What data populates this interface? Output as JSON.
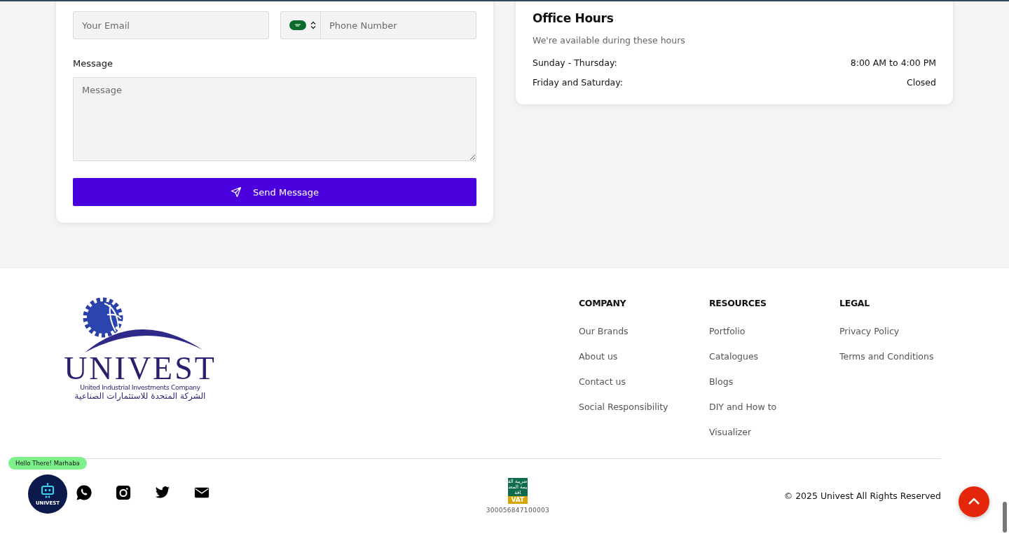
{
  "contact_form": {
    "email": {
      "placeholder": "Your Email"
    },
    "phone": {
      "placeholder": "Phone Number"
    },
    "message_label": "Message",
    "message": {
      "placeholder": "Message"
    },
    "submit": "Send Message"
  },
  "office_hours": {
    "title": "Office Hours",
    "subtitle": "We're available during these hours",
    "rows": [
      {
        "days": "Sunday - Thursday:",
        "hours": "8:00 AM to 4:00 PM"
      },
      {
        "days": "Friday and Saturday:",
        "hours": "Closed"
      }
    ]
  },
  "footer": {
    "logo": {
      "name": "UNIVEST",
      "tagline": "United Industrial Investments Company",
      "arabic": "الشركة المتحدة للاستثمارات الصناعية"
    },
    "columns": [
      {
        "title": "COMPANY",
        "links": [
          "Our Brands",
          "About us",
          "Contact us",
          "Social Responsibility"
        ]
      },
      {
        "title": "RESOURCES",
        "links": [
          "Portfolio",
          "Catalogues",
          "Blogs",
          "DIY and How to",
          "Visualizer"
        ]
      },
      {
        "title": "LEGAL",
        "links": [
          "Privacy Policy",
          "Terms and Conditions"
        ]
      }
    ],
    "vat": {
      "badge_text": "ضريبة القيمة المضافة",
      "badge_label": "VAT",
      "number": "300056847100003"
    },
    "copyright": "© 2025 Univest All Rights Reserved"
  },
  "chat": {
    "greeting": "Hello There! Marhaba",
    "avatar_label": "UNIVEST"
  }
}
